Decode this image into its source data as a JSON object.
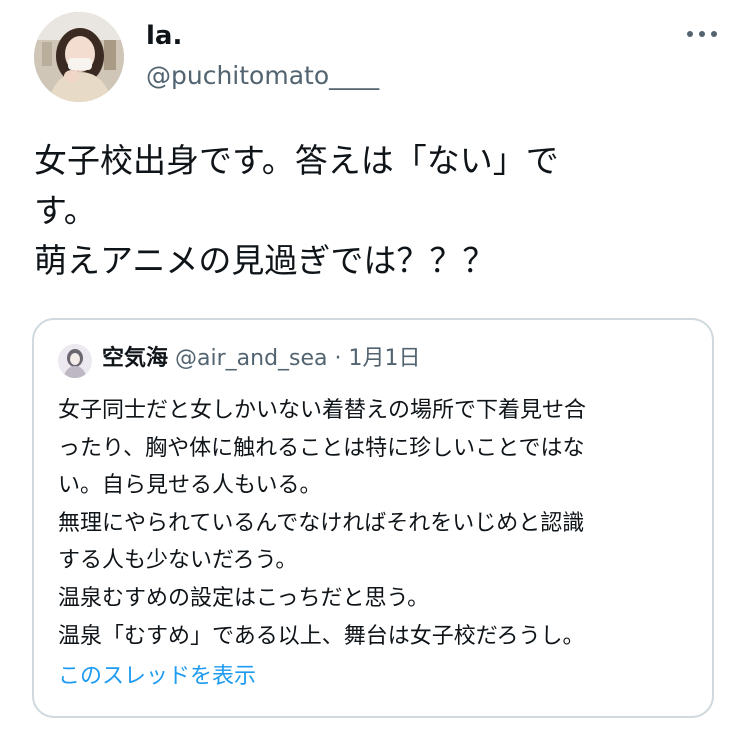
{
  "tweet": {
    "display_name": "la.",
    "handle": "@puchitomato____",
    "more_icon": "more-horizontal-icon",
    "text_lines": [
      "女子校出身です。答えは「ない」で",
      "す。",
      "萌えアニメの見過ぎでは？？？"
    ]
  },
  "quote": {
    "display_name": "空気海",
    "handle": "@air_and_sea",
    "separator": "·",
    "date": "1月1日",
    "text_lines": [
      "女子同士だと女しかいない着替えの場所で下着見せ合",
      "ったり、胸や体に触れることは特に珍しいことではな",
      "い。自ら見せる人もいる。",
      "無理にやられているんでなければそれをいじめと認識",
      "する人も少ないだろう。",
      "温泉むすめの設定はこっちだと思う。",
      "温泉「むすめ」である以上、舞台は女子校だろうし。"
    ],
    "show_thread_label": "このスレッドを表示"
  },
  "colors": {
    "text": "#0f1419",
    "secondary": "#536471",
    "link": "#1d9bf0",
    "border": "#cfd9de"
  }
}
